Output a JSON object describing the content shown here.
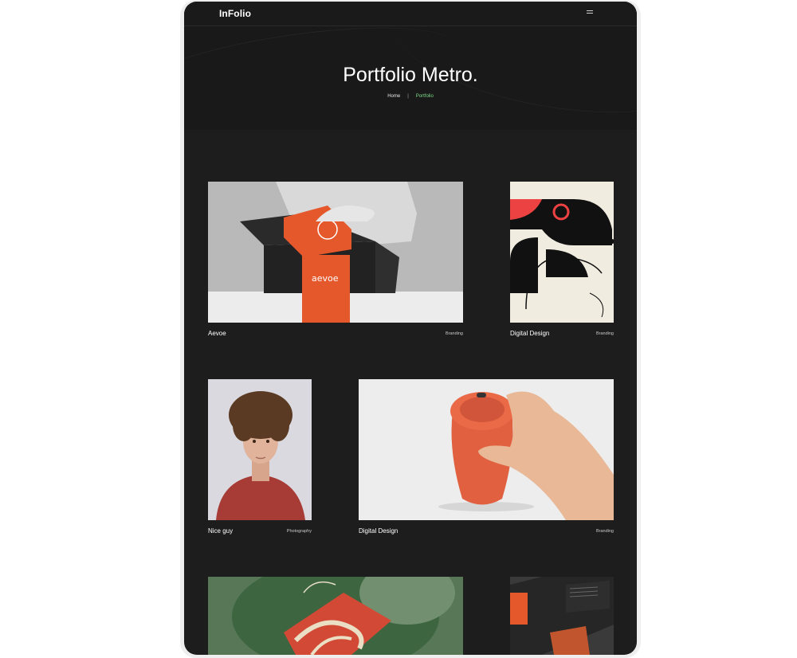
{
  "nav": {
    "logo": "InFolio"
  },
  "hero": {
    "title": "Portfolio Metro.",
    "crumb_home": "Home",
    "crumb_sep": "|",
    "crumb_current": "Portfolio"
  },
  "projects": [
    {
      "name": "Aevoe",
      "category": "Branding"
    },
    {
      "name": "Digital Design",
      "category": "Branding"
    },
    {
      "name": "Nice guy",
      "category": "Photography"
    },
    {
      "name": "Digital Design",
      "category": "Branding"
    }
  ],
  "colors": {
    "accent": "#7fdc8a",
    "background": "#1d1d1d",
    "brand_orange": "#e5582c"
  }
}
